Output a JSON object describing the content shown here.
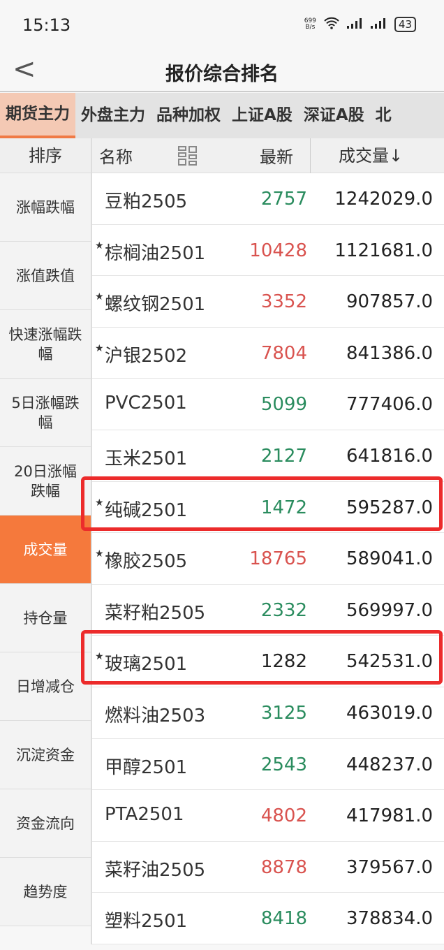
{
  "status": {
    "time": "15:13",
    "speed_value": "699",
    "speed_unit": "B/s",
    "battery": "43"
  },
  "header": {
    "title": "报价综合排名"
  },
  "tabs": [
    "期货主力",
    "外盘主力",
    "品种加权",
    "上证A股",
    "深证A股",
    "北"
  ],
  "sidebar": {
    "header": "排序",
    "items": [
      "涨幅跌幅",
      "涨值跌值",
      "快速涨幅跌幅",
      "5日涨幅跌幅",
      "20日涨幅跌幅",
      "成交量",
      "持仓量",
      "日增减仓",
      "沉淀资金",
      "资金流向",
      "趋势度"
    ],
    "active_index": 5
  },
  "columns": {
    "name": "名称",
    "latest": "最新",
    "volume": "成交量↓"
  },
  "colors": {
    "up": "#d9534f",
    "down": "#2a8c5e",
    "accent": "#f5793c",
    "highlight_box": "#ec2b2b"
  },
  "rows": [
    {
      "star": false,
      "name": "豆粕2505",
      "price": "2757",
      "trend": "down",
      "volume": "1242029.0"
    },
    {
      "star": true,
      "name": "棕榈油2501",
      "price": "10428",
      "trend": "up",
      "volume": "1121681.0"
    },
    {
      "star": true,
      "name": "螺纹钢2501",
      "price": "3352",
      "trend": "up",
      "volume": "907857.0"
    },
    {
      "star": true,
      "name": "沪银2502",
      "price": "7804",
      "trend": "up",
      "volume": "841386.0"
    },
    {
      "star": false,
      "name": "PVC2501",
      "price": "5099",
      "trend": "down",
      "volume": "777406.0"
    },
    {
      "star": false,
      "name": "玉米2501",
      "price": "2127",
      "trend": "down",
      "volume": "641816.0"
    },
    {
      "star": true,
      "name": "纯碱2501",
      "price": "1472",
      "trend": "down",
      "volume": "595287.0",
      "highlighted": true
    },
    {
      "star": true,
      "name": "橡胶2505",
      "price": "18765",
      "trend": "up",
      "volume": "589041.0"
    },
    {
      "star": false,
      "name": "菜籽粕2505",
      "price": "2332",
      "trend": "down",
      "volume": "569997.0"
    },
    {
      "star": true,
      "name": "玻璃2501",
      "price": "1282",
      "trend": "flat",
      "volume": "542531.0",
      "highlighted": true
    },
    {
      "star": false,
      "name": "燃料油2503",
      "price": "3125",
      "trend": "down",
      "volume": "463019.0"
    },
    {
      "star": false,
      "name": "甲醇2501",
      "price": "2543",
      "trend": "down",
      "volume": "448237.0"
    },
    {
      "star": false,
      "name": "PTA2501",
      "price": "4802",
      "trend": "up",
      "volume": "417981.0"
    },
    {
      "star": false,
      "name": "菜籽油2505",
      "price": "8878",
      "trend": "up",
      "volume": "379567.0"
    },
    {
      "star": false,
      "name": "塑料2501",
      "price": "8418",
      "trend": "down",
      "volume": "378834.0"
    }
  ]
}
